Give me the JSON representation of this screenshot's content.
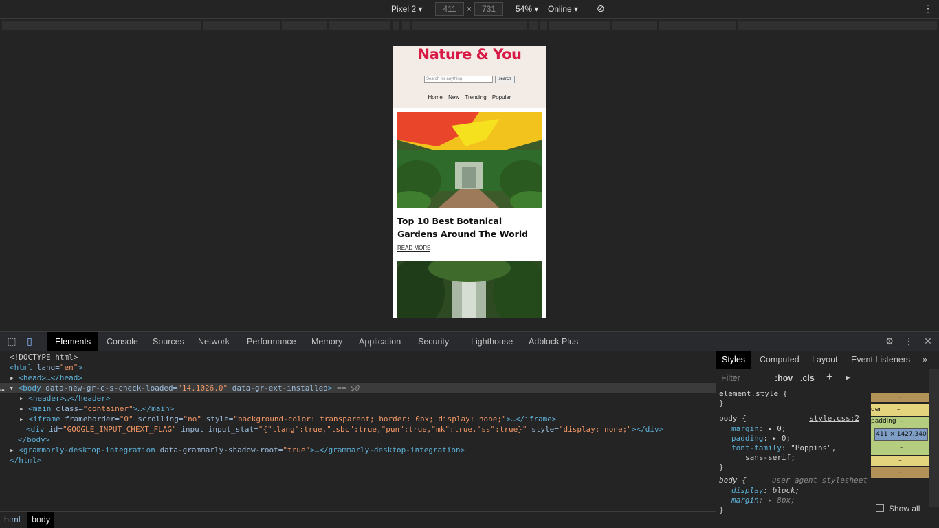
{
  "device_toolbar": {
    "device": "Pixel 2",
    "width": "411",
    "x": "×",
    "height": "731",
    "zoom": "54%",
    "network": "Online"
  },
  "site": {
    "title": "Nature & You",
    "search_placeholder": "Search for anything",
    "search_button": "search",
    "nav": [
      "Home",
      "New",
      "Trending",
      "Popular"
    ],
    "article_title": "Top 10 Best Botanical Gardens Around The World",
    "read_more": "READ MORE"
  },
  "devtools": {
    "tabs": [
      "Elements",
      "Console",
      "Sources",
      "Network",
      "Performance",
      "Memory",
      "Application",
      "Security",
      "Lighthouse",
      "Adblock Plus"
    ],
    "active_tab": "Elements",
    "dom": {
      "l1": "<!DOCTYPE html>",
      "l2_tag": "<html ",
      "l2_attr": "lang=",
      "l2_val": "\"en\"",
      "l2_end": ">",
      "l3": "<head>…</head>",
      "l4_open": "<body ",
      "l4_attr1": "data-new-gr-c-s-check-loaded=",
      "l4_val1": "\"14.1026.0\"",
      "l4_attr2": " data-gr-ext-installed",
      "l4_end": ">",
      "l4_marker": " == $0",
      "l5": "<header>…</header>",
      "l6_tag": "<main ",
      "l6_attr": "class=",
      "l6_val": "\"container\"",
      "l6_end": ">…</main>",
      "l7_tag": "<iframe ",
      "l7_a1": "frameborder=",
      "l7_v1": "\"0\"",
      "l7_a2": " scrolling=",
      "l7_v2": "\"no\"",
      "l7_a3": " style=",
      "l7_v3": "\"background-color: transparent; border: 0px; display: none;\"",
      "l7_end": ">…</iframe>",
      "l8_tag": "<div ",
      "l8_a1": "id=",
      "l8_v1": "\"GOOGLE_INPUT_CHEXT_FLAG\"",
      "l8_a2": " input input_stat=",
      "l8_v2": "\"{\"tlang\":true,\"tsbc\":true,\"pun\":true,\"mk\":true,\"ss\":true}\"",
      "l8_a3": " style=",
      "l8_v3": "\"display: none;\"",
      "l8_end": "></div>",
      "l9": "</body>",
      "l10_tag": "<grammarly-desktop-integration ",
      "l10_attr": "data-grammarly-shadow-root=",
      "l10_val": "\"true\"",
      "l10_end": ">…</grammarly-desktop-integration>",
      "l11": "</html>"
    },
    "breadcrumbs": [
      "html",
      "body"
    ],
    "styles_tabs": [
      "Styles",
      "Computed",
      "Layout",
      "Event Listeners"
    ],
    "filter_placeholder": "Filter",
    "hov": ":hov",
    "cls": ".cls",
    "styles": {
      "element_style": "element.style {",
      "close": "}",
      "body_sel": "body {",
      "source": "style.css:2",
      "margin": "margin",
      "margin_val": ": ▸ 0;",
      "padding": "padding",
      "padding_val": ": ▸ 0;",
      "font_family": "font-family",
      "font_family_val": ": \"Poppins\",",
      "font_family_val2": "sans-serif;",
      "ua_sel": "body {",
      "ua_label": "user agent stylesheet",
      "display": "display",
      "display_val": ": block;",
      "ua_margin": "margin",
      "ua_margin_val": ": ▸ 8px;"
    },
    "box_model": {
      "size": "411 × 1427.340",
      "label_border": "der",
      "label_padding": "padding",
      "dash": "–"
    },
    "show_all": "Show all"
  }
}
